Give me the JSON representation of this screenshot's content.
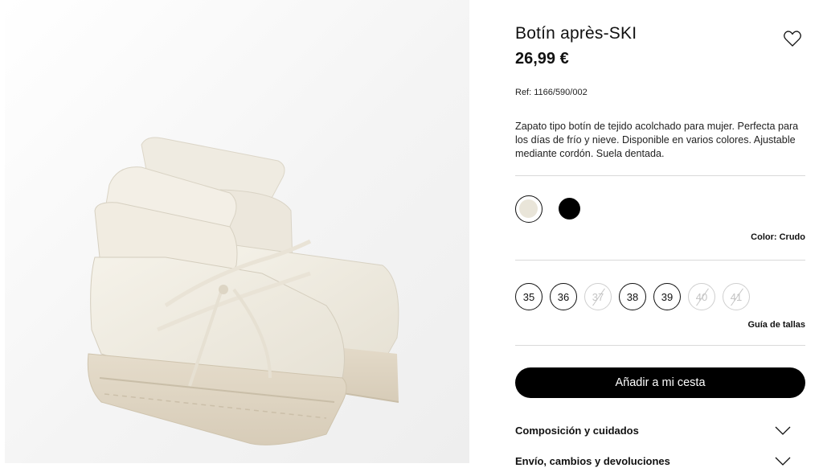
{
  "product": {
    "title": "Botín après-SKI",
    "price": "26,99 €",
    "ref": "Ref: 1166/590/002",
    "description": "Zapato tipo botín de tejido acolchado para mujer. Perfecta para los días de frío y nieve. Disponible en varios colores. Ajustable mediante cordón. Suela dentada.",
    "image_icon": "snow-boot-photo"
  },
  "colors": {
    "options": [
      {
        "name": "Crudo",
        "hex": "#e9e5d9",
        "selected": true
      },
      {
        "name": "Negro",
        "hex": "#000000",
        "selected": false
      }
    ],
    "label": "Color: Crudo"
  },
  "sizes": {
    "options": [
      {
        "label": "35",
        "available": true
      },
      {
        "label": "36",
        "available": true
      },
      {
        "label": "37",
        "available": false
      },
      {
        "label": "38",
        "available": true
      },
      {
        "label": "39",
        "available": true
      },
      {
        "label": "40",
        "available": false
      },
      {
        "label": "41",
        "available": false
      }
    ],
    "guide_label": "Guía de tallas"
  },
  "actions": {
    "add_to_cart": "Añadir a mi cesta",
    "favorite_icon": "heart-icon"
  },
  "accordion": [
    {
      "label": "Composición y cuidados",
      "icon": "chevron-down-icon"
    },
    {
      "label": "Envío, cambios y devoluciones",
      "icon": "chevron-down-icon"
    }
  ]
}
